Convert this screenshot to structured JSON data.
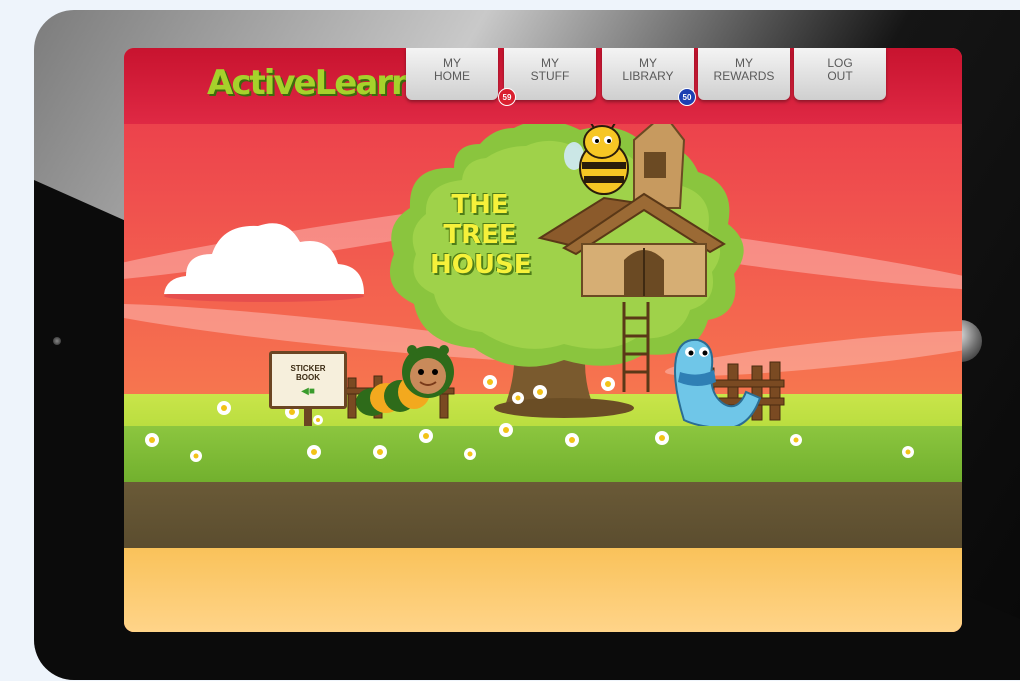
{
  "app": {
    "logo_text": "ActiveLearn"
  },
  "nav": {
    "items": [
      {
        "line1": "MY",
        "line2": "HOME"
      },
      {
        "line1": "MY",
        "line2": "STUFF",
        "badge": "59"
      },
      {
        "line1": "MY",
        "line2": "LIBRARY",
        "badge": "50"
      },
      {
        "line1": "MY",
        "line2": "REWARDS"
      },
      {
        "line1": "LOG",
        "line2": "OUT"
      }
    ]
  },
  "scene": {
    "title_lines": [
      "THE",
      "TREE",
      "HOUSE"
    ],
    "sign_lines": [
      "STICKER",
      "BOOK"
    ]
  },
  "colors": {
    "topbar": "#d21c38",
    "sky": "#f25a4f",
    "logo": "#a6d22b",
    "badge_stuff": "#d9202f",
    "badge_library": "#1d3fb2",
    "title_text": "#f6f13a"
  },
  "icons": [
    "tree-house",
    "bee-character",
    "caterpillar-character",
    "worm-character",
    "cloud",
    "sticker-sign-arrow-icon"
  ]
}
